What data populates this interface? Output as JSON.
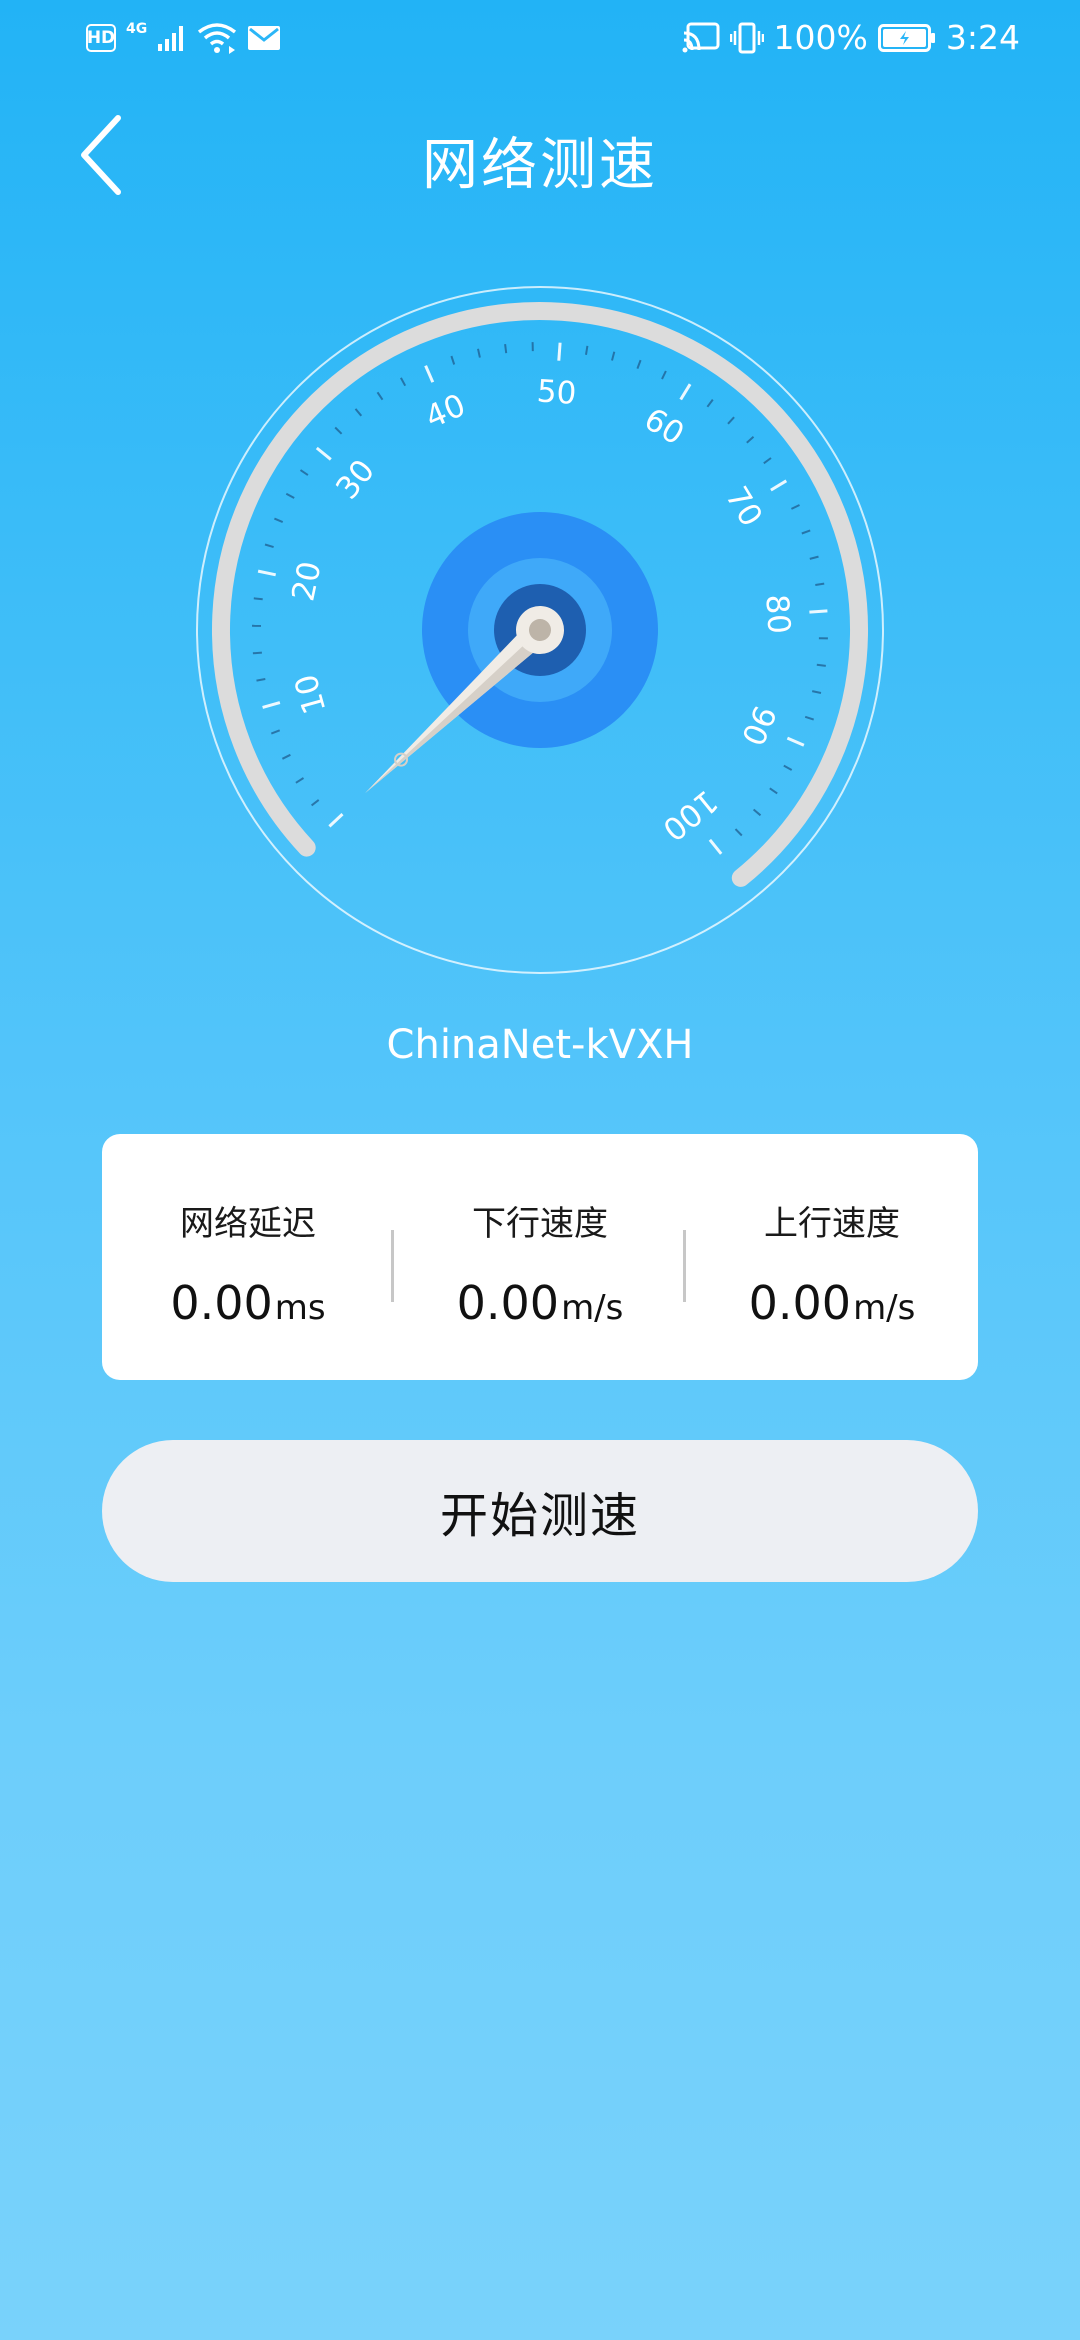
{
  "status_bar": {
    "hd": "HD",
    "network": "4G",
    "battery": "100%",
    "time": "3:24"
  },
  "header": {
    "title": "网络测速"
  },
  "gauge": {
    "value": 0,
    "min": 0,
    "max": 100,
    "tick_labels": [
      "10",
      "20",
      "30",
      "40",
      "50",
      "60",
      "70",
      "80",
      "90",
      "100"
    ]
  },
  "network_name": "ChinaNet-kVXH",
  "stats": {
    "latency": {
      "label": "网络延迟",
      "value": "0.00",
      "unit": "ms"
    },
    "download": {
      "label": "下行速度",
      "value": "0.00",
      "unit": "m/s"
    },
    "upload": {
      "label": "上行速度",
      "value": "0.00",
      "unit": "m/s"
    }
  },
  "start_button": {
    "label": "开始测速"
  },
  "colors": {
    "gauge_ring": "#dcdcdc",
    "hub_outer": "#2a8ff5",
    "hub_mid": "#3fa9f9",
    "hub_inner": "#1e5fb0",
    "needle": "#f0ece6",
    "card": "#ffffff",
    "button": "#edeff3"
  }
}
